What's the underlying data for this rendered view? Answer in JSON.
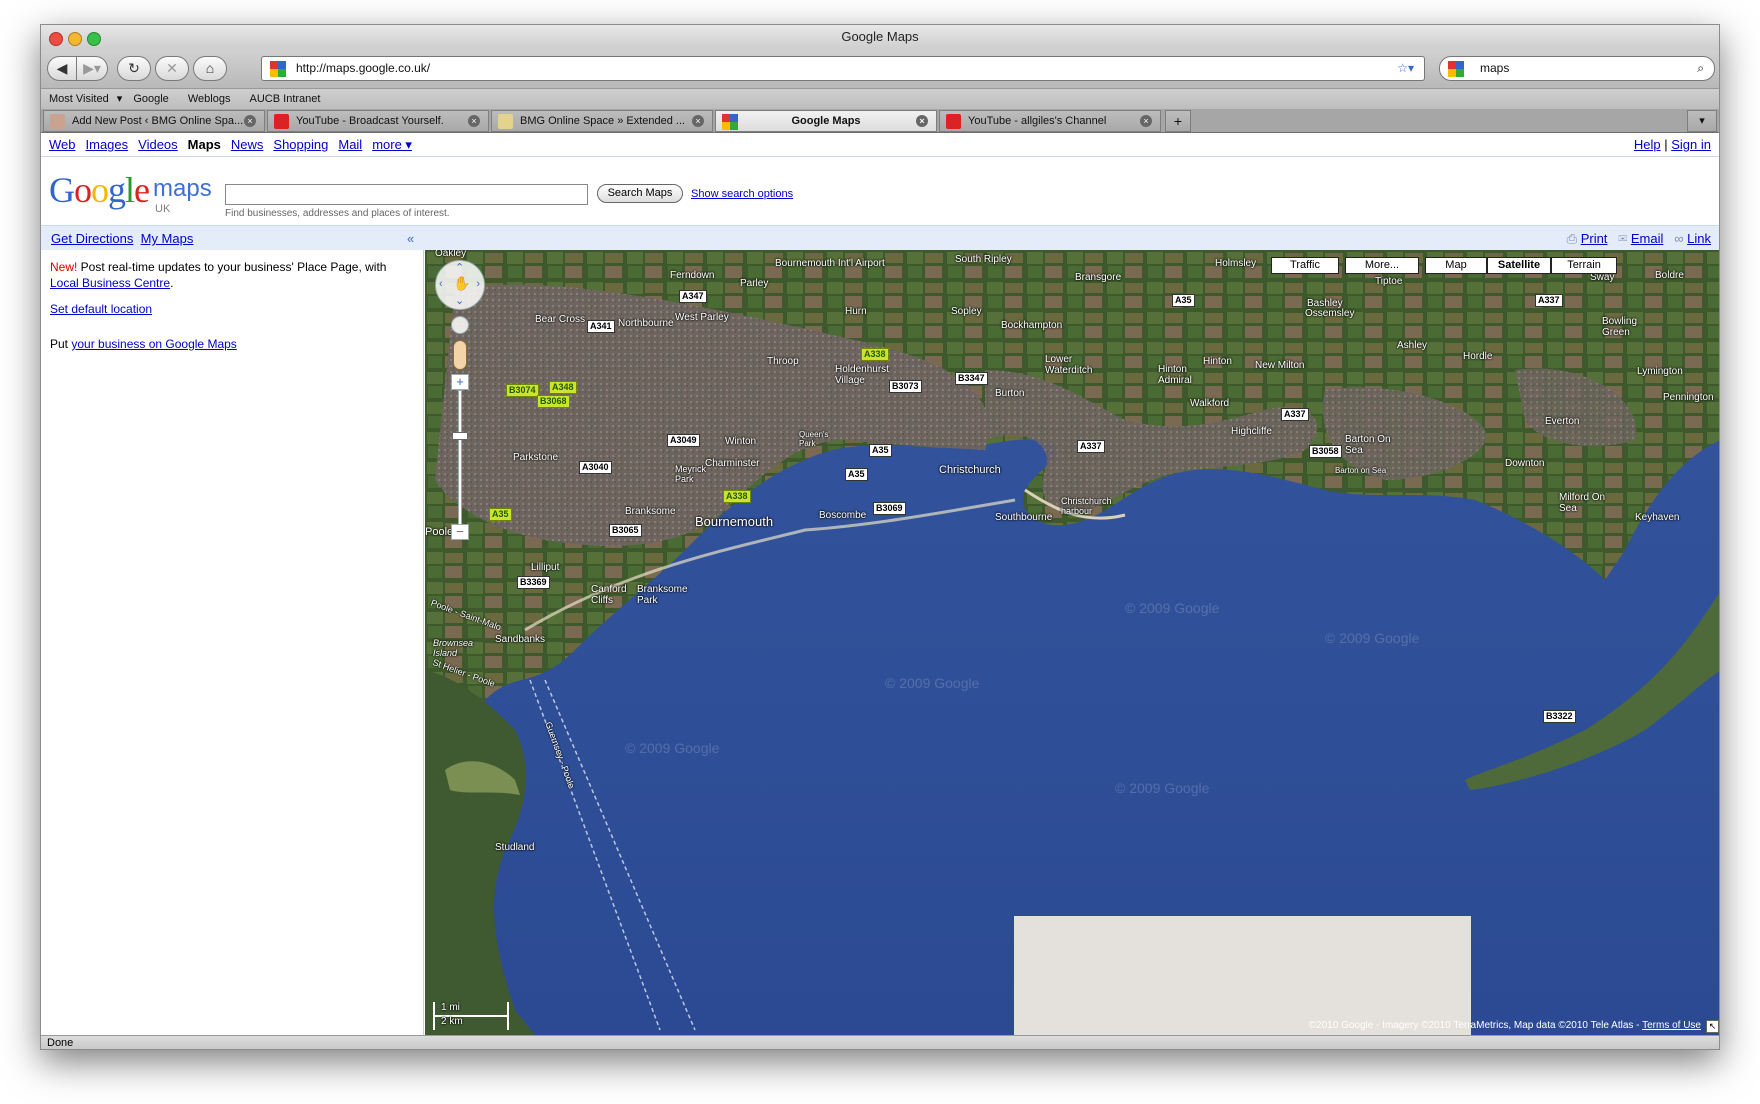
{
  "window": {
    "title": "Google Maps"
  },
  "browser": {
    "url": "http://maps.google.co.uk/",
    "search_value": "maps",
    "bookmarks": [
      "Most Visited",
      "Google",
      "Weblogs",
      "AUCB Intranet"
    ],
    "tabs": [
      {
        "label": "Add New Post ‹ BMG Online Spa...",
        "active": false
      },
      {
        "label": "YouTube - Broadcast Yourself.",
        "active": false
      },
      {
        "label": "BMG Online Space » Extended ...",
        "active": false
      },
      {
        "label": "Google Maps",
        "active": true
      },
      {
        "label": "YouTube - allgiles's Channel",
        "active": false
      }
    ],
    "status": "Done"
  },
  "gbar": {
    "links": [
      "Web",
      "Images",
      "Videos",
      "Maps",
      "News",
      "Shopping",
      "Mail",
      "more ▾"
    ],
    "current": "Maps",
    "help": "Help",
    "sign_in": "Sign in"
  },
  "search": {
    "logo_word": "Google",
    "logo_product": "maps",
    "logo_region": "UK",
    "button": "Search Maps",
    "options_link": "Show search options",
    "hint": "Find businesses, addresses and places of interest."
  },
  "panel": {
    "get_directions": "Get Directions",
    "my_maps": "My Maps",
    "collapse": "«",
    "print": "Print",
    "email": "Email",
    "link": "Link"
  },
  "sidebar": {
    "new_label": "New!",
    "new_text": " Post real-time updates to your business' Place Page, with",
    "local_link": "Local Business Centre",
    "period": ".",
    "set_default": "Set default location",
    "put_text": "Put ",
    "business_link": "your business on Google Maps"
  },
  "map": {
    "buttons": {
      "traffic": "Traffic",
      "more": "More...",
      "map": "Map",
      "satellite": "Satellite",
      "terrain": "Terrain"
    },
    "selected_type": "Satellite",
    "scale": {
      "mi": "1 mi",
      "km": "2 km"
    },
    "copyright": "©2010 Google - Imagery ©2010 TerraMetrics, Map data ©2010 Tele Atlas - ",
    "terms": "Terms of Use",
    "watermark": "© 2009 Google",
    "places": [
      "Oakley",
      "Ferndown",
      "Bournemouth Int'l Airport",
      "Parley",
      "South Ripley",
      "Bransgore",
      "Holmsley",
      "Tiptoe",
      "Sway",
      "Boldre",
      "Ossemsley",
      "Bashley",
      "Bear Cross",
      "Northbourne",
      "West Parley",
      "Hurn",
      "Sopley",
      "Bockhampton",
      "Bowling Green",
      "Ashley",
      "Hordle",
      "Lymington",
      "Throop",
      "Holdenhurst Village",
      "Lower Waterditch",
      "Hinton Admiral",
      "Hinton",
      "New Milton",
      "Pennington",
      "Burton",
      "Walkford",
      "Everton",
      "Parkstone",
      "Winton",
      "Queen's Park",
      "Highcliffe",
      "Barton On Sea",
      "Downton",
      "Charminster",
      "Meyrick Park",
      "Christchurch",
      "Bournemouth",
      "Boscombe",
      "Southbourne",
      "Christchurch harbour",
      "Milford On Sea",
      "Keyhaven",
      "Branksome",
      "Poole",
      "Lilliput",
      "Canford Cliffs",
      "Branksome Park",
      "Sandbanks",
      "Brownsea Island",
      "Studland",
      "Poole - Saint-Malo",
      "St Helier - Poole",
      "Guernsey - Poole",
      "Barton on Sea"
    ],
    "roads_white": [
      "A347",
      "A341",
      "A35",
      "B3347",
      "B3073",
      "B3069",
      "A3049",
      "A3040",
      "A35",
      "A35",
      "A337",
      "A337",
      "B3058",
      "B3065",
      "B3369",
      "A337",
      "B3322"
    ],
    "roads_green": [
      "A338",
      "B3074",
      "A348",
      "B3068",
      "A35",
      "A338"
    ]
  }
}
